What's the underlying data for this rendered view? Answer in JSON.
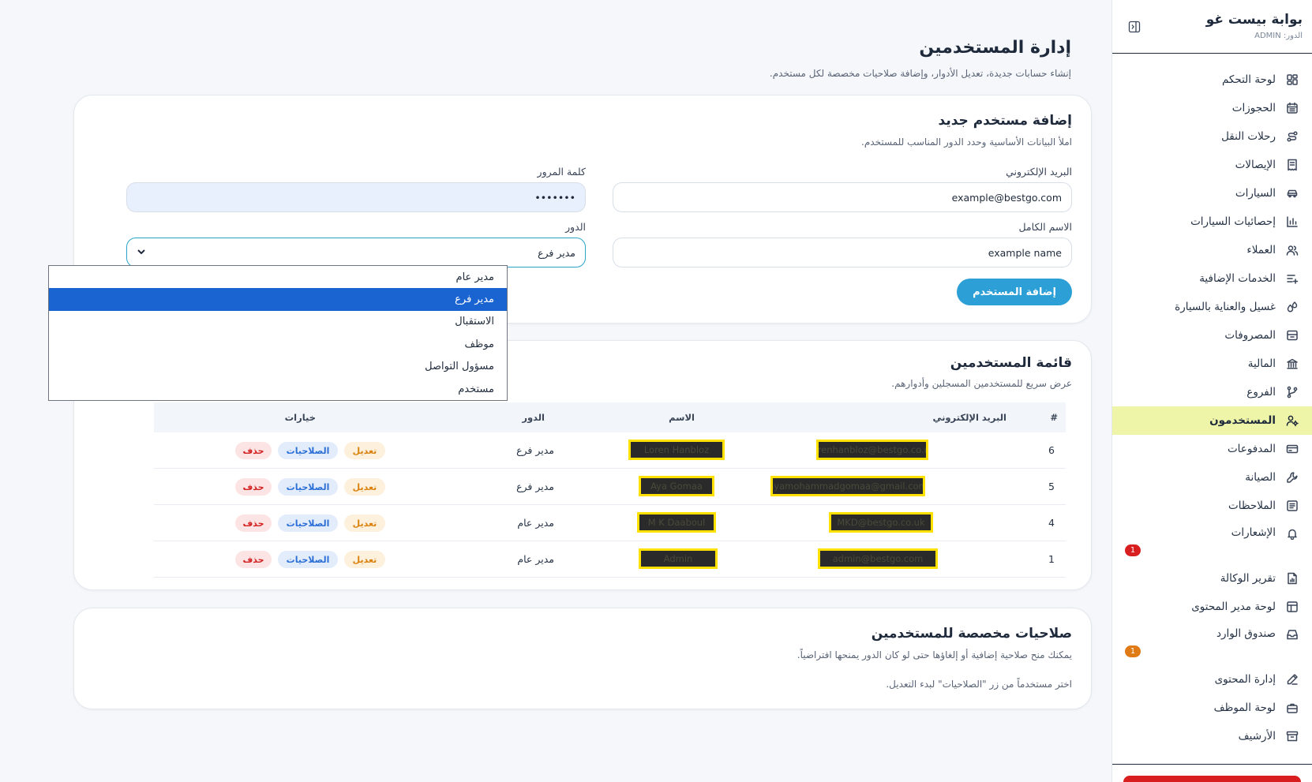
{
  "sidebar": {
    "brand_title": "بوابة بيست غو",
    "brand_role": "الدور: ADMIN",
    "items": [
      {
        "label": "لوحة التحكم",
        "icon": "grid-icon"
      },
      {
        "label": "الحجوزات",
        "icon": "calendar-icon"
      },
      {
        "label": "رحلات النقل",
        "icon": "route-icon"
      },
      {
        "label": "الإيصالات",
        "icon": "receipt-icon"
      },
      {
        "label": "السيارات",
        "icon": "car-icon"
      },
      {
        "label": "إحصائيات السيارات",
        "icon": "bar-chart-icon"
      },
      {
        "label": "العملاء",
        "icon": "users-icon"
      },
      {
        "label": "الخدمات الإضافية",
        "icon": "list-plus-icon"
      },
      {
        "label": "غسيل والعناية بالسيارة",
        "icon": "droplets-icon"
      },
      {
        "label": "المصروفات",
        "icon": "archive-box-icon"
      },
      {
        "label": "المالية",
        "icon": "bank-icon"
      },
      {
        "label": "الفروع",
        "icon": "branch-icon"
      },
      {
        "label": "المستخدمون",
        "icon": "user-cog-icon",
        "active": true
      },
      {
        "label": "المدفوعات",
        "icon": "credit-card-icon"
      },
      {
        "label": "الصيانة",
        "icon": "wrench-icon"
      },
      {
        "label": "الملاحظات",
        "icon": "note-icon"
      },
      {
        "label": "الإشعارات",
        "icon": "bell-icon",
        "badge": "1"
      },
      {
        "label": "تقرير الوكالة",
        "icon": "report-icon"
      },
      {
        "label": "لوحة مدير المحتوى",
        "icon": "layout-icon"
      },
      {
        "label": "صندوق الوارد",
        "icon": "inbox-icon",
        "badge": "1"
      },
      {
        "label": "إدارة المحتوى",
        "icon": "pen-icon"
      },
      {
        "label": "لوحة الموظف",
        "icon": "briefcase-icon"
      },
      {
        "label": "الأرشيف",
        "icon": "archive-icon"
      }
    ]
  },
  "page": {
    "title": "إدارة المستخدمين",
    "subtitle": "إنشاء حسابات جديدة، تعديل الأدوار، وإضافة صلاحيات مخصصة لكل مستخدم."
  },
  "add_user": {
    "title": "إضافة مستخدم جديد",
    "subtitle": "املأ البيانات الأساسية وحدد الدور المناسب للمستخدم.",
    "email_label": "البريد الإلكتروني",
    "email_value": "example@bestgo.com",
    "password_label": "كلمة المرور",
    "password_value": "•••••••",
    "name_label": "الاسم الكامل",
    "name_value": "example name",
    "role_label": "الدور",
    "role_value": "مدير فرع",
    "submit_label": "إضافة المستخدم",
    "role_options": [
      "مدير عام",
      "مدير فرع",
      "الاستقبال",
      "موظف",
      "مسؤول التواصل",
      "مستخدم"
    ],
    "selected_option": "مدير فرع"
  },
  "users_list": {
    "title": "قائمة المستخدمين",
    "subtitle": "عرض سريع للمستخدمين المسجلين وأدوارهم.",
    "columns": {
      "num": "#",
      "email": "البريد الإلكتروني",
      "name": "الاسم",
      "role": "الدور",
      "options": "خيارات"
    },
    "actions": {
      "edit": "تعديل",
      "permissions": "الصلاحيات",
      "delete": "حذف"
    },
    "rows": [
      {
        "num": "6",
        "email": "lorenhanbloz@bestgo.co.uk",
        "name": "Loren Hanbloz",
        "role": "مدير فرع"
      },
      {
        "num": "5",
        "email": "ayamohammadgomaa@gmail.com",
        "name": "Aya Gomaa",
        "role": "مدير فرع"
      },
      {
        "num": "4",
        "email": "MKD@bestgo.co.uk",
        "name": "M K Daaboul",
        "role": "مدير عام"
      },
      {
        "num": "1",
        "email": "admin@bestgo.com",
        "name": "Admin",
        "role": "مدير عام"
      }
    ]
  },
  "custom_perms": {
    "title": "صلاحيات مخصصة للمستخدمين",
    "subtitle": "يمكنك منح صلاحية إضافية أو إلغاؤها حتى لو كان الدور يمنحها افتراضياً.",
    "hint": "اختر مستخدماً من زر \"الصلاحيات\" لبدء التعديل."
  },
  "colors": {
    "accent": "#2b9fd6",
    "active_nav": "#eef5a8",
    "dropdown_selected": "#1a64d1",
    "redaction_border": "#ffe100"
  }
}
